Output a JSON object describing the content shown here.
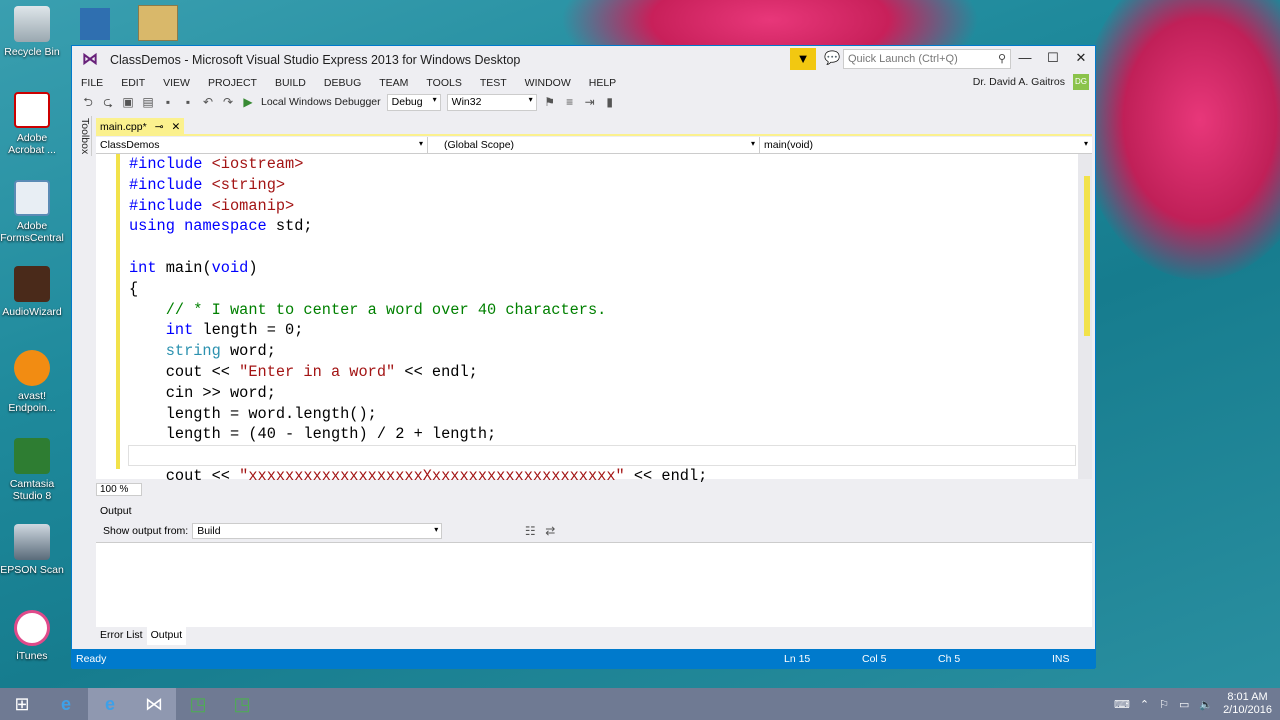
{
  "desktop": {
    "icons": [
      {
        "label": "Recycle Bin",
        "icon": "recycle-bin-icon"
      },
      {
        "label": "Adobe Acrobat ...",
        "icon": "acrobat-icon"
      },
      {
        "label": "Adobe FormsCentral",
        "icon": "formscentral-icon"
      },
      {
        "label": "AudioWizard",
        "icon": "audiowizard-icon"
      },
      {
        "label": "avast! Endpoin...",
        "icon": "avast-icon"
      },
      {
        "label": "Camtasia Studio 8",
        "icon": "camtasia-icon"
      },
      {
        "label": "EPSON Scan",
        "icon": "epson-icon"
      },
      {
        "label": "iTunes",
        "icon": "itunes-icon"
      }
    ]
  },
  "window": {
    "title": "ClassDemos - Microsoft Visual Studio Express 2013 for Windows Desktop",
    "quick_launch_placeholder": "Quick Launch (Ctrl+Q)",
    "user": "Dr. David A. Gaitros",
    "avatar": "DG"
  },
  "menu": [
    "FILE",
    "EDIT",
    "VIEW",
    "PROJECT",
    "BUILD",
    "DEBUG",
    "TEAM",
    "TOOLS",
    "TEST",
    "WINDOW",
    "HELP"
  ],
  "toolbar": {
    "debugger": "Local Windows Debugger",
    "config": "Debug",
    "platform": "Win32"
  },
  "sidebar_label": "Toolbox",
  "editor": {
    "tab": "main.cpp*",
    "nav_project": "ClassDemos",
    "nav_scope": "(Global Scope)",
    "nav_member": "main(void)",
    "zoom": "100 %"
  },
  "code_lines": [
    "#include <iostream>",
    "#include <string>",
    "#include <iomanip>",
    "using namespace std;",
    "",
    "int main(void)",
    "{",
    "    // * I want to center a word over 40 characters.",
    "    int length = 0;",
    "    string word;",
    "    cout << \"Enter in a word\" << endl;",
    "    cin >> word;",
    "    length = word.length();",
    "    length = (40 - length) / 2 + length;",
    "",
    "    cout << \"xxxxxxxxxxxxxxxxxxxXxxxxxxxxxxxxxxxxxxxx\" << endl;"
  ],
  "output": {
    "title": "Output",
    "show_from_label": "Show output from:",
    "source": "Build",
    "tabs": [
      "Error List",
      "Output"
    ]
  },
  "status": {
    "state": "Ready",
    "ln": "Ln 15",
    "col": "Col 5",
    "ch": "Ch 5",
    "mode": "INS"
  },
  "clock": {
    "time": "8:01 AM",
    "date": "2/10/2016"
  }
}
